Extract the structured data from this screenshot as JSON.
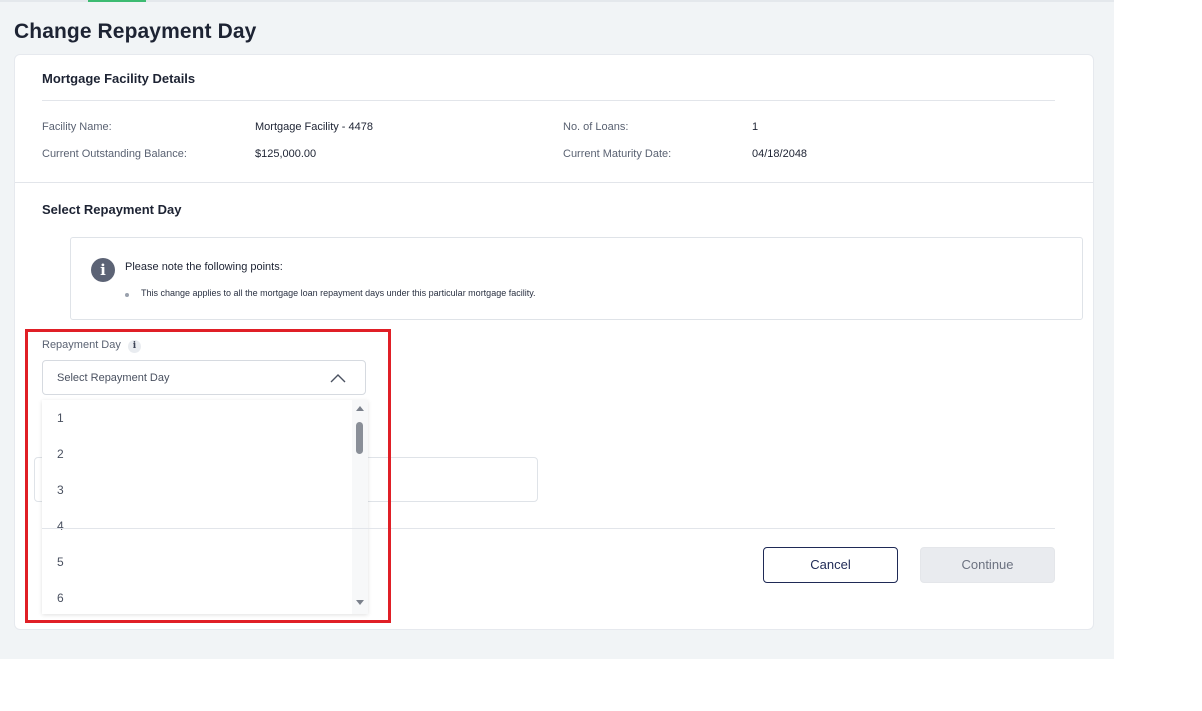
{
  "page": {
    "title": "Change Repayment Day"
  },
  "facility": {
    "section_title": "Mortgage Facility Details",
    "name_label": "Facility Name:",
    "name_value": "Mortgage Facility - 4478",
    "loans_label": "No. of Loans:",
    "loans_value": "1",
    "balance_label": "Current Outstanding Balance:",
    "balance_value": "$125,000.00",
    "maturity_label": "Current Maturity Date:",
    "maturity_value": "04/18/2048"
  },
  "repayment": {
    "section_title": "Select Repayment Day",
    "note_icon": "info-icon",
    "note_title": "Please note the following points:",
    "note_points": [
      "This change applies to all the mortgage loan repayment days under this particular mortgage facility."
    ],
    "field_label": "Repayment Day",
    "field_info_icon": "info-icon",
    "select_placeholder": "Select Repayment Day",
    "select_icon": "chevron-up-icon",
    "options": [
      "1",
      "2",
      "3",
      "4",
      "5",
      "6"
    ]
  },
  "actions": {
    "cancel_label": "Cancel",
    "continue_label": "Continue"
  },
  "colors": {
    "page_background": "#f1f4f6",
    "accent": "#3dbb72",
    "highlight_border": "#e01f26",
    "primary_outline": "#1f2a56",
    "disabled_button": "#e9ebef"
  }
}
